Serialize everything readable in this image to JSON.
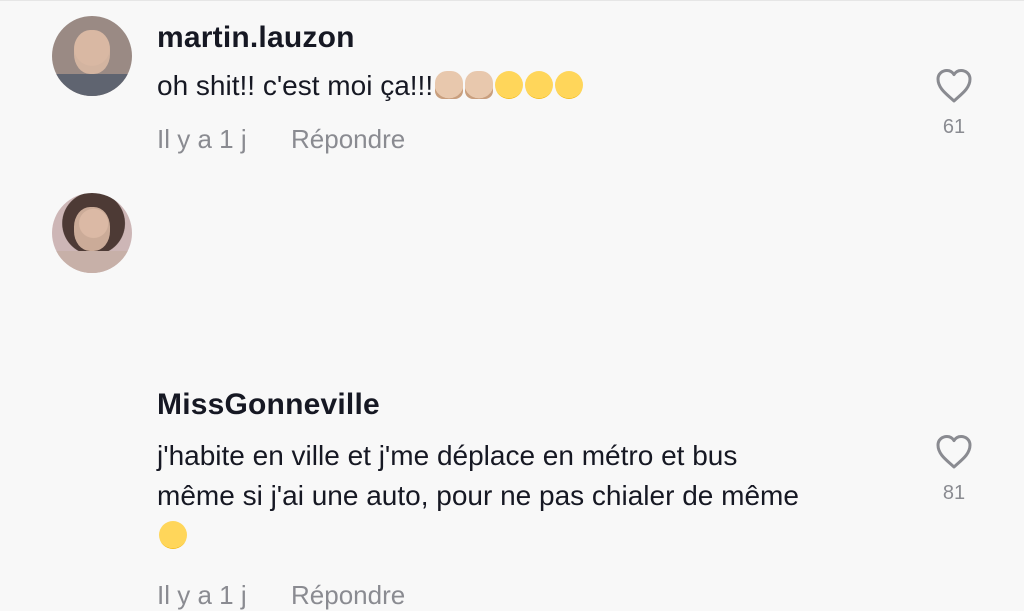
{
  "comments": [
    {
      "username": "martin.lauzon",
      "text": "oh shit!! c'est moi ça!!!",
      "emojis": [
        "person-raising-hand",
        "person-facepalming",
        "face-with-tears-of-joy",
        "face-with-tears-of-joy",
        "face-with-tears-of-joy"
      ],
      "time": "Il y a 1 j",
      "reply_label": "Répondre",
      "likes": "61"
    },
    {
      "username": "MissGonneville",
      "text_lines": [
        "j'habite en ville et j'me déplace en métro et bus",
        "même si j'ai une auto, pour ne pas chialer de même"
      ],
      "emojis": [
        "grinning-squinting-face"
      ],
      "time": "Il y a 1 j",
      "reply_label": "Répondre",
      "likes": "81"
    }
  ],
  "colors": {
    "background": "#f8f8f8",
    "text": "#161823",
    "muted": "#8a8b91"
  }
}
